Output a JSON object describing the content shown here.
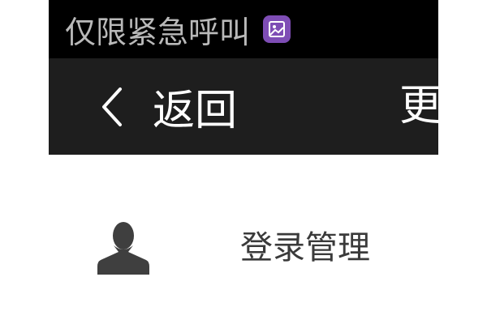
{
  "status_bar": {
    "text": "仅限紧急呼叫",
    "notification_icon": "gallery-icon",
    "icon_color": "#7e4db5"
  },
  "toolbar": {
    "back_icon": "chevron-left-icon",
    "back_label": "返回",
    "more_label": "更"
  },
  "menu": {
    "items": [
      {
        "icon": "person-icon",
        "label": "登录管理"
      }
    ]
  }
}
